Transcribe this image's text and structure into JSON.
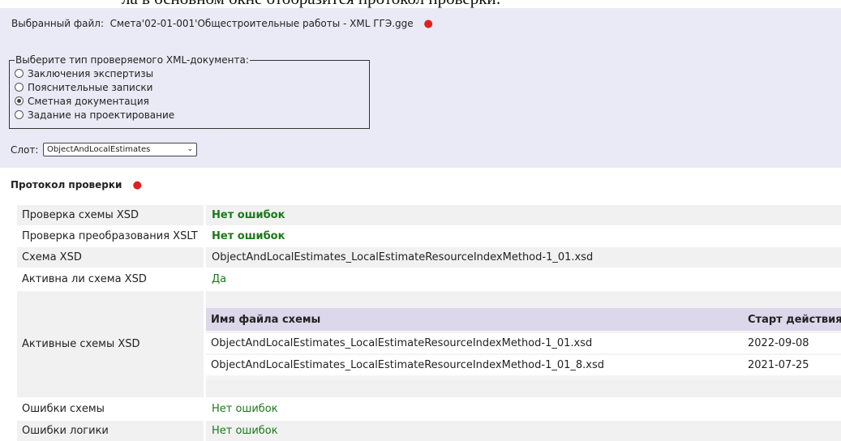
{
  "cropped_header": "ла в основном окне отобразится протокол проверки:",
  "top": {
    "selected_file_label": "Выбранный файл:",
    "selected_file_name": "Смета'02-01-001'Общестроительные работы - XML ГГЭ.gge",
    "indicator": "●",
    "doc_type_legend": "Выберите тип проверяемого XML-документа:",
    "doc_types": [
      {
        "label": "Заключения экспертизы",
        "checked": false
      },
      {
        "label": "Пояснительные записки",
        "checked": false
      },
      {
        "label": "Сметная документация",
        "checked": true
      },
      {
        "label": "Задание на проектирование",
        "checked": false
      }
    ],
    "slot_label": "Слот:",
    "slot_value": "ObjectAndLocalEstimates",
    "chevron": "⌄"
  },
  "protocol": {
    "title": "Протокол проверки",
    "indicator": "●",
    "rows": [
      {
        "label": "Проверка схемы XSD",
        "value": "Нет ошибок"
      },
      {
        "label": "Проверка преобразования XSLT",
        "value": "Нет ошибок"
      },
      {
        "label": "Схема XSD",
        "value": "ObjectAndLocalEstimates_LocalEstimateResourceIndexMethod-1_01.xsd"
      },
      {
        "label": "Активна ли схема XSD",
        "value": "Да"
      },
      {
        "label": "Активные схемы XSD",
        "value": ""
      },
      {
        "label": "Ошибки схемы",
        "value": "Нет ошибок"
      },
      {
        "label": "Ошибки логики",
        "value": "Нет ошибок"
      }
    ],
    "active_schemas": {
      "headers": [
        "Имя файла схемы",
        "Старт действия"
      ],
      "rows": [
        [
          "ObjectAndLocalEstimates_LocalEstimateResourceIndexMethod-1_01.xsd",
          "2022-09-08"
        ],
        [
          "ObjectAndLocalEstimates_LocalEstimateResourceIndexMethod-1_01_8.xsd",
          "2021-07-25"
        ]
      ]
    }
  },
  "colors": {
    "panel_bg": "#eaeaf6",
    "ok_green": "#1a7a1a",
    "indicator_red": "#e02020",
    "inner_header_bg": "#dcd7ea"
  }
}
